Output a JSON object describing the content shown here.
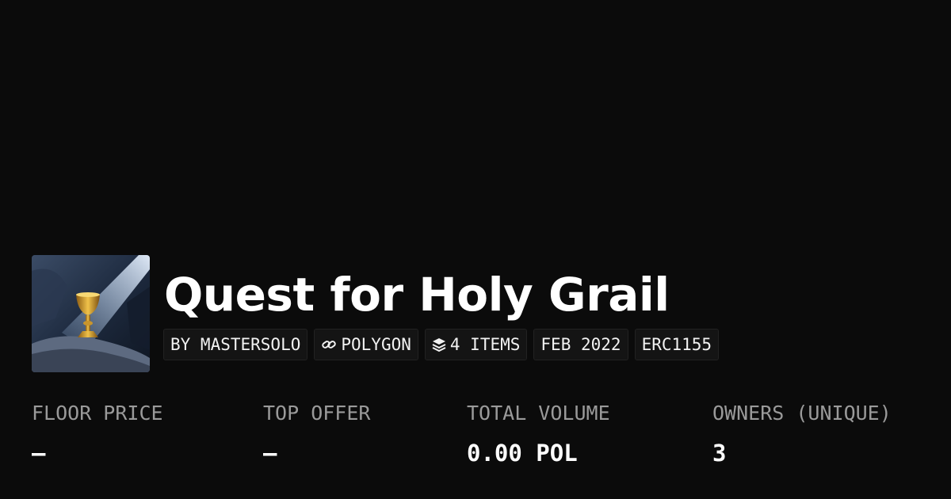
{
  "collection": {
    "title": "Quest for Holy Grail",
    "avatar_icon": "holy-grail-image"
  },
  "chips": {
    "creator": "BY MASTERSOLO",
    "chain": "POLYGON",
    "chain_icon": "chain-link-icon",
    "items": "4 ITEMS",
    "items_icon": "layers-icon",
    "date": "FEB 2022",
    "standard": "ERC1155"
  },
  "stats": [
    {
      "label": "FLOOR PRICE",
      "value": "–"
    },
    {
      "label": "TOP OFFER",
      "value": "–"
    },
    {
      "label": "TOTAL VOLUME",
      "value": "0.00 POL"
    },
    {
      "label": "OWNERS (UNIQUE)",
      "value": "3"
    }
  ],
  "colors": {
    "background": "#0b0b0b",
    "chip_background": "#141414",
    "label": "#9a9a9a",
    "text": "#ffffff"
  }
}
